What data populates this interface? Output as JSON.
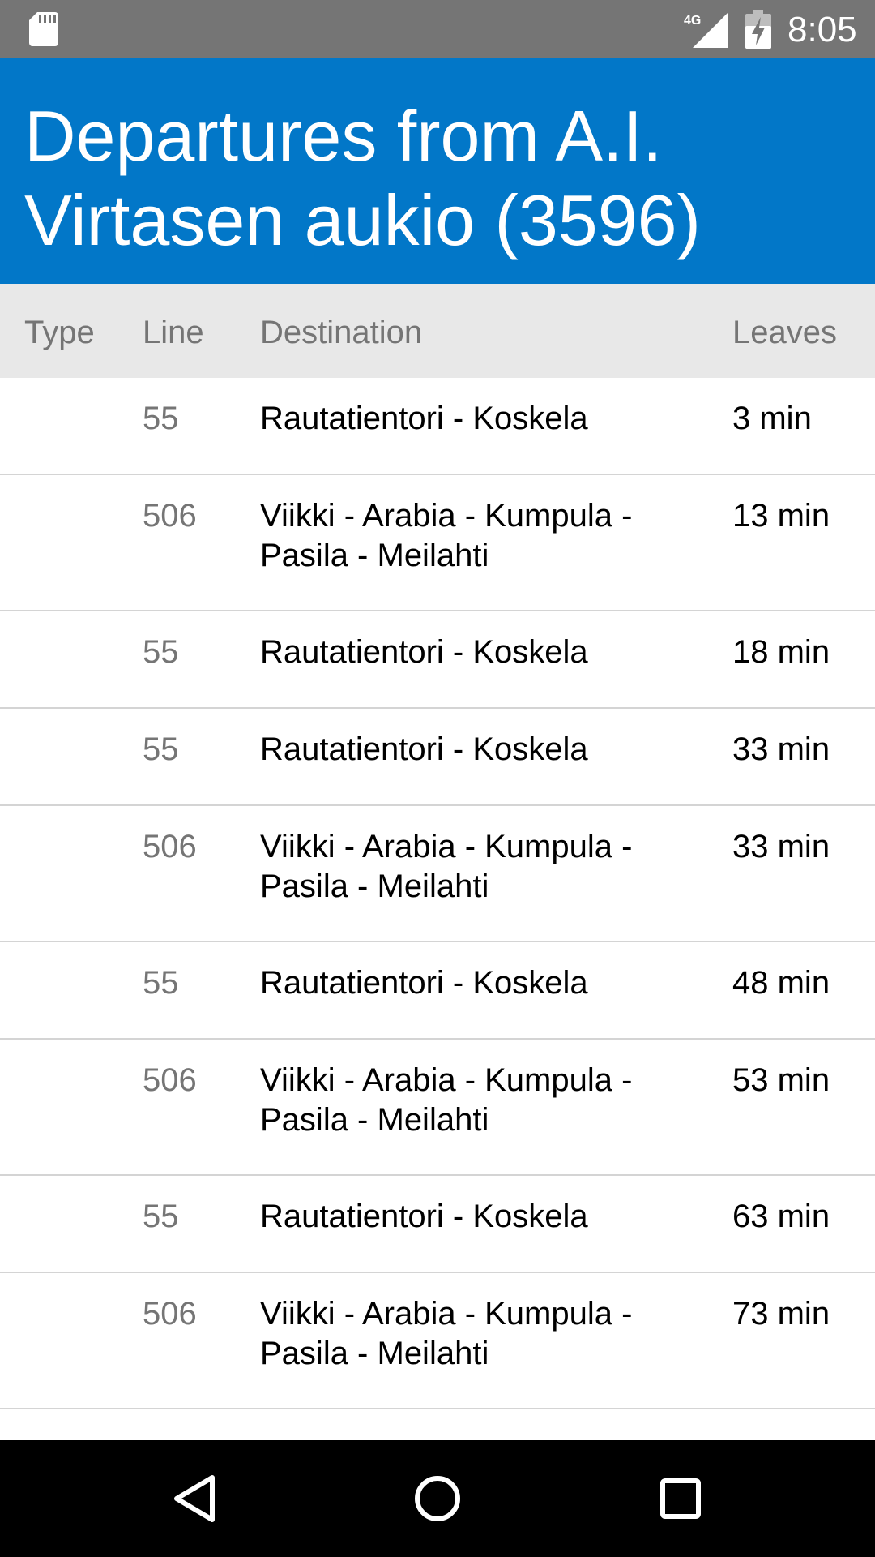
{
  "status_bar": {
    "network": "4G",
    "time": "8:05",
    "icons": [
      "sd-card-icon",
      "signal-icon",
      "battery-charging-icon"
    ]
  },
  "app_bar": {
    "title": "Departures from A.I. Virtasen aukio (3596)"
  },
  "table": {
    "headers": {
      "type": "Type",
      "line": "Line",
      "destination": "Destination",
      "leaves": "Leaves"
    },
    "rows": [
      {
        "type": "",
        "line": "55",
        "destination": "Rautatientori - Koskela",
        "leaves": "3 min"
      },
      {
        "type": "",
        "line": "506",
        "destination": "Viikki - Arabia - Kumpula - Pasila - Meilahti",
        "leaves": "13 min"
      },
      {
        "type": "",
        "line": "55",
        "destination": "Rautatientori - Koskela",
        "leaves": "18 min"
      },
      {
        "type": "",
        "line": "55",
        "destination": "Rautatientori - Koskela",
        "leaves": "33 min"
      },
      {
        "type": "",
        "line": "506",
        "destination": "Viikki - Arabia - Kumpula - Pasila - Meilahti",
        "leaves": "33 min"
      },
      {
        "type": "",
        "line": "55",
        "destination": "Rautatientori - Koskela",
        "leaves": "48 min"
      },
      {
        "type": "",
        "line": "506",
        "destination": "Viikki - Arabia - Kumpula - Pasila - Meilahti",
        "leaves": "53 min"
      },
      {
        "type": "",
        "line": "55",
        "destination": "Rautatientori - Koskela",
        "leaves": "63 min"
      },
      {
        "type": "",
        "line": "506",
        "destination": "Viikki - Arabia - Kumpula - Pasila - Meilahti",
        "leaves": "73 min"
      }
    ]
  },
  "nav_bar": {
    "icons": [
      "back-icon",
      "home-icon",
      "recent-apps-icon"
    ]
  },
  "colors": {
    "status_bar": "#757575",
    "app_bar": "#0277c8",
    "header_bg": "#e8e8e8",
    "divider": "#d4d4d4",
    "nav_bar": "#000000"
  }
}
